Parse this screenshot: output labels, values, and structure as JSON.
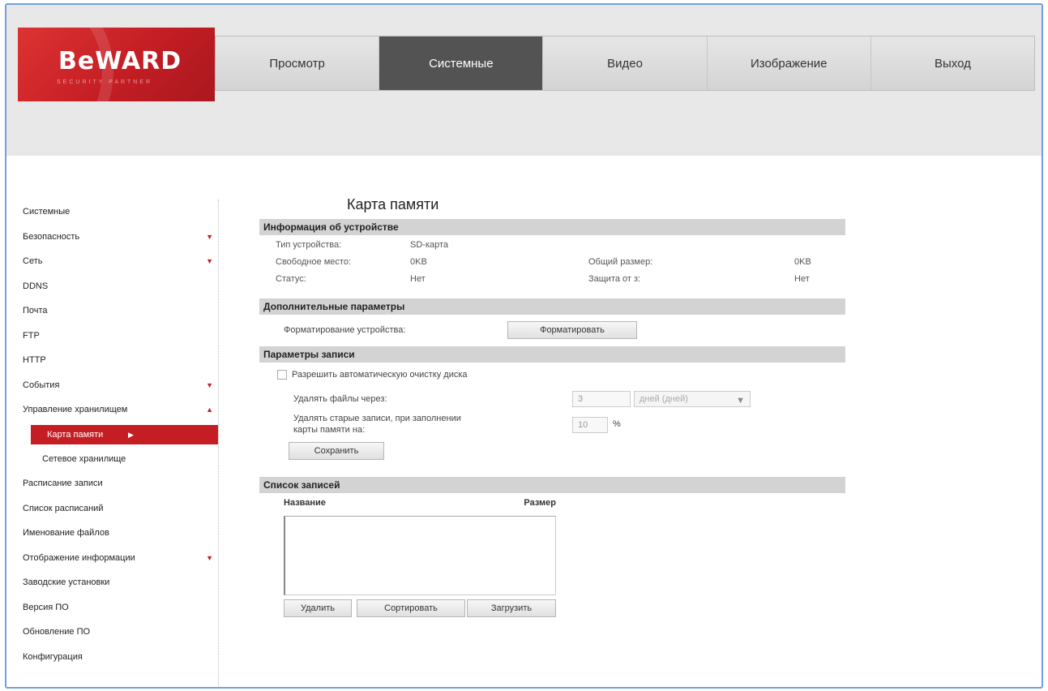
{
  "logo": {
    "brand": "BeWARD",
    "tagline": "SECURITY PARTNER"
  },
  "nav": [
    {
      "label": "Просмотр",
      "active": false
    },
    {
      "label": "Системные",
      "active": true
    },
    {
      "label": "Видео",
      "active": false
    },
    {
      "label": "Изображение",
      "active": false
    },
    {
      "label": "Выход",
      "active": false
    }
  ],
  "sidebar": {
    "items": [
      {
        "label": "Системные",
        "type": "item",
        "arrow": ""
      },
      {
        "label": "Безопасность",
        "type": "item",
        "arrow": "▼"
      },
      {
        "label": "Сеть",
        "type": "item",
        "arrow": "▼"
      },
      {
        "label": "DDNS",
        "type": "item",
        "arrow": ""
      },
      {
        "label": "Почта",
        "type": "item",
        "arrow": ""
      },
      {
        "label": "FTP",
        "type": "item",
        "arrow": ""
      },
      {
        "label": "HTTP",
        "type": "item",
        "arrow": ""
      },
      {
        "label": "События",
        "type": "item",
        "arrow": "▼"
      },
      {
        "label": "Управление хранилищем",
        "type": "item",
        "arrow": "▲"
      },
      {
        "label": "Карта памяти",
        "type": "active",
        "arrow": "▶"
      },
      {
        "label": "Сетевое хранилище",
        "type": "sub",
        "arrow": ""
      },
      {
        "label": "Расписание записи",
        "type": "item",
        "arrow": ""
      },
      {
        "label": "Список расписаний",
        "type": "item",
        "arrow": ""
      },
      {
        "label": "Именование файлов",
        "type": "item",
        "arrow": ""
      },
      {
        "label": "Отображение информации",
        "type": "item",
        "arrow": "▼"
      },
      {
        "label": "Заводские установки",
        "type": "item",
        "arrow": ""
      },
      {
        "label": "Версия ПО",
        "type": "item",
        "arrow": ""
      },
      {
        "label": "Обновление ПО",
        "type": "item",
        "arrow": ""
      },
      {
        "label": "Конфигурация",
        "type": "item",
        "arrow": ""
      }
    ]
  },
  "page_title": "Карта памяти",
  "device_info": {
    "header": "Информация об устройстве",
    "type_label": "Тип устройства:",
    "type_value": "SD-карта",
    "free_label": "Свободное место:",
    "free_value": "0KB",
    "total_label": "Общий размер:",
    "total_value": "0KB",
    "status_label": "Статус:",
    "status_value": "Нет",
    "protect_label": "Защита от з:",
    "protect_value": "Нет"
  },
  "extra": {
    "header": "Дополнительные параметры",
    "format_label": "Форматирование устройства:",
    "format_button": "Форматировать"
  },
  "record": {
    "header": "Параметры записи",
    "auto_clean_label": "Разрешить автоматическую очистку диска",
    "auto_clean_checked": false,
    "delete_after_label": "Удалять файлы через:",
    "delete_after_value": "3",
    "delete_after_unit": "дней (дней)",
    "delete_old_label_1": "Удалять старые записи, при заполнении",
    "delete_old_label_2": "карты памяти на:",
    "delete_old_value": "10",
    "percent": "%",
    "save_button": "Сохранить"
  },
  "records_list": {
    "header": "Список записей",
    "col_name": "Название",
    "col_size": "Размер",
    "delete_button": "Удалить",
    "sort_button": "Сортировать",
    "load_button": "Загрузить"
  }
}
